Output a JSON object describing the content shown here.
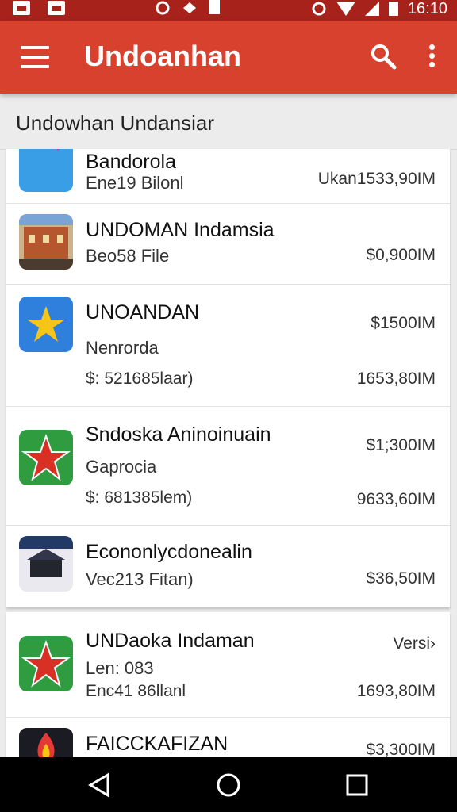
{
  "status_bar": {
    "time": "16:10"
  },
  "app_bar": {
    "title": "Undoanhan"
  },
  "subheader": {
    "text": "Undowhan Undansiar"
  },
  "list": [
    {
      "title": "Bandorola",
      "subtitle": "Ene19 Bilonl",
      "right": "Ukan1533,90IM"
    },
    {
      "title": "UNDOMAN Indamsia",
      "subtitle": "Beo58 File",
      "right": "$0,900IM"
    },
    {
      "title": "UNOANDAN",
      "subtitle": "Nenrorda",
      "detail": "$: 521685laar)",
      "right_top": "$1500IM",
      "right": "1653,80IM"
    },
    {
      "title": "Sndoska Aninoinuain",
      "subtitle": "Gaprocia",
      "detail": "$: 681385lem)",
      "right_top": "$1;300IM",
      "right": "9633,60IM"
    },
    {
      "title": "Econonlycdonealin",
      "subtitle": "Vec213 Fitan)",
      "right": "$36,50IM"
    }
  ],
  "list2": [
    {
      "title": "UNDaoka Indaman",
      "subtitle": "Len: 083",
      "detail": "Enc41 86llanl",
      "right_top": "Versi›",
      "right": "1693,80IM"
    },
    {
      "title": "FAICCKAFIZAN",
      "right": "$3,300IM"
    }
  ],
  "colors": {
    "status_bar": "#a8221c",
    "app_bar": "#d9412f",
    "background": "#ececec"
  },
  "icons": [
    "menu-icon",
    "search-icon",
    "more-vert-icon",
    "back-icon",
    "home-icon",
    "recents-icon"
  ]
}
